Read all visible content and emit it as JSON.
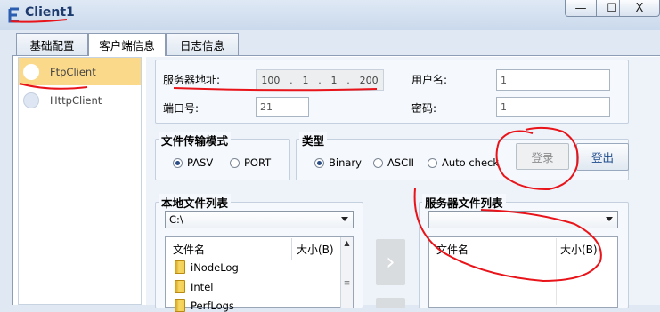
{
  "window": {
    "title": "Client1",
    "minimize_glyph": "—",
    "maximize_glyph": "☐",
    "close_glyph": "X"
  },
  "tabs": [
    {
      "label": "基础配置",
      "active": false
    },
    {
      "label": "客户端信息",
      "active": true
    },
    {
      "label": "日志信息",
      "active": false
    }
  ],
  "client_list": [
    {
      "label": "FtpClient",
      "selected": true
    },
    {
      "label": "HttpClient",
      "selected": false
    }
  ],
  "server": {
    "address_label": "服务器地址:",
    "ip": [
      "100",
      "1",
      "1",
      "200"
    ],
    "port_label": "端口号:",
    "port_value": "21",
    "username_label": "用户名:",
    "username_value": "1",
    "password_label": "密码:",
    "password_value": "1"
  },
  "transfer_mode": {
    "title": "文件传输模式",
    "options": [
      {
        "label": "PASV",
        "checked": true
      },
      {
        "label": "PORT",
        "checked": false
      }
    ]
  },
  "type": {
    "title": "类型",
    "options": [
      {
        "label": "Binary",
        "checked": true
      },
      {
        "label": "ASCII",
        "checked": false
      },
      {
        "label": "Auto check",
        "checked": false
      }
    ]
  },
  "buttons": {
    "login": "登录",
    "logout": "登出"
  },
  "local_files": {
    "title": "本地文件列表",
    "drive": "C:\\",
    "col_name": "文件名",
    "col_size": "大小(B)",
    "items": [
      "iNodeLog",
      "Intel",
      "PerfLogs"
    ]
  },
  "server_files": {
    "title": "服务器文件列表",
    "drive": "",
    "col_name": "文件名",
    "col_size": "大小(B)"
  },
  "transfer": {
    "upload_glyph": "›"
  },
  "colors": {
    "selected_item": "#fbd98b",
    "annotation_red": "#e8141a",
    "title_text": "#1d3b6e"
  }
}
